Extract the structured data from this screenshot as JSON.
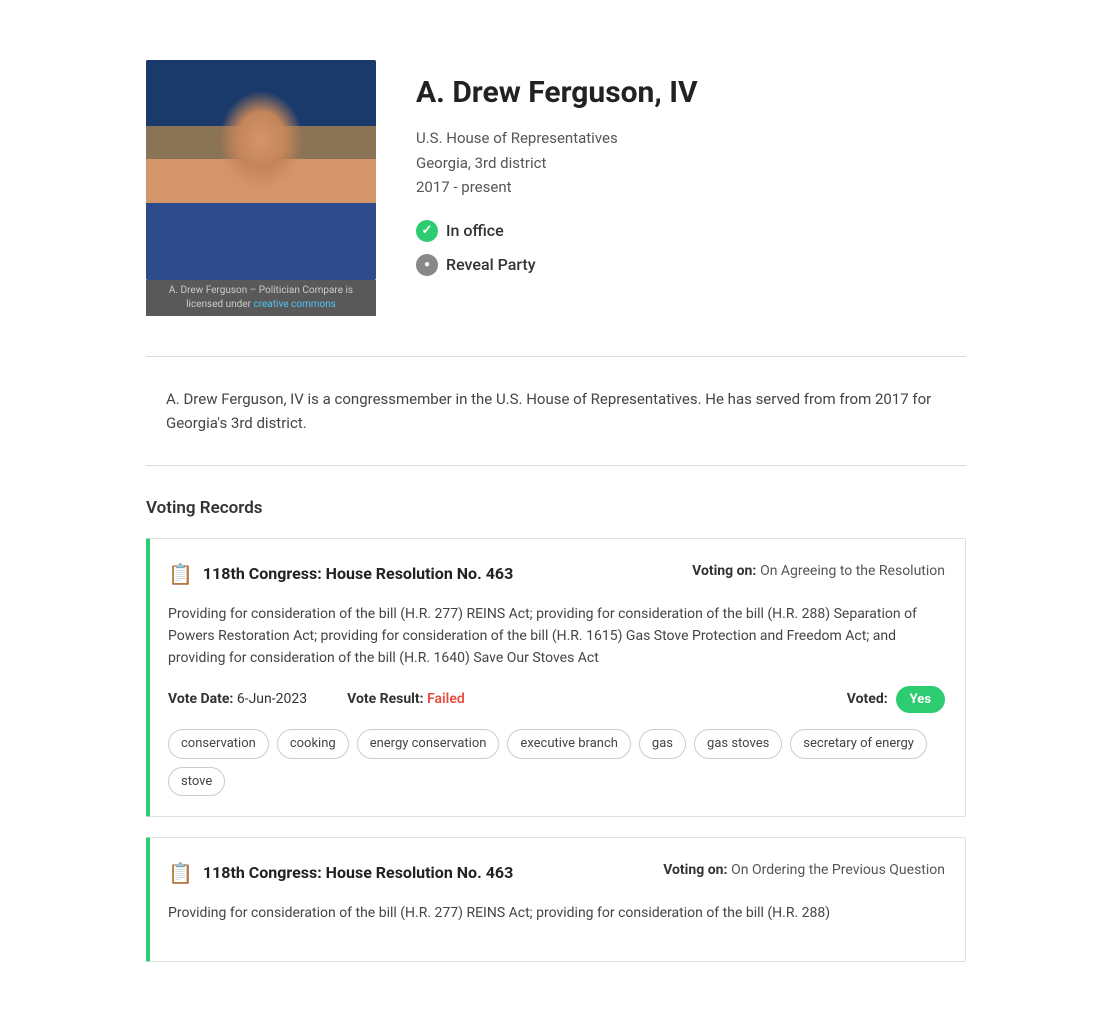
{
  "politician": {
    "name": "A. Drew Ferguson, IV",
    "role": "U.S. House of Representatives",
    "district": "Georgia, 3rd district",
    "term": "2017 - present",
    "status": "In office",
    "reveal_party": "Reveal Party",
    "bio": "A. Drew Ferguson, IV is a congressmember in the U.S. House of Representatives. He has served from from 2017 for Georgia's 3rd district.",
    "image_caption_text": "A. Drew Ferguson – Politician Compare",
    "image_caption_license": "is licensed under",
    "image_caption_link": "creative commons"
  },
  "voting_records_section": {
    "title": "Voting Records"
  },
  "voting_records": [
    {
      "congress": "118th Congress: House Resolution No. 463",
      "voting_on_label": "Voting on:",
      "voting_on": "On Agreeing to the Resolution",
      "description": "Providing for consideration of the bill (H.R. 277) REINS Act; providing for consideration of the bill (H.R. 288) Separation of Powers Restoration Act; providing for consideration of the bill (H.R. 1615) Gas Stove Protection and Freedom Act; and providing for consideration of the bill (H.R. 1640) Save Our Stoves Act",
      "vote_date_label": "Vote Date:",
      "vote_date": "6-Jun-2023",
      "vote_result_label": "Vote Result:",
      "vote_result": "Failed",
      "voted_label": "Voted:",
      "voted_value": "Yes",
      "tags": [
        "conservation",
        "cooking",
        "energy conservation",
        "executive branch",
        "gas",
        "gas stoves",
        "secretary of energy",
        "stove"
      ]
    },
    {
      "congress": "118th Congress: House Resolution No. 463",
      "voting_on_label": "Voting on:",
      "voting_on": "On Ordering the Previous Question",
      "description": "Providing for consideration of the bill (H.R. 277) REINS Act; providing for consideration of the bill (H.R. 288)",
      "vote_date_label": "",
      "vote_date": "",
      "vote_result_label": "",
      "vote_result": "",
      "voted_label": "",
      "voted_value": "",
      "tags": []
    }
  ],
  "colors": {
    "accent_green": "#2ecc71",
    "failed_red": "#e74c3c"
  }
}
